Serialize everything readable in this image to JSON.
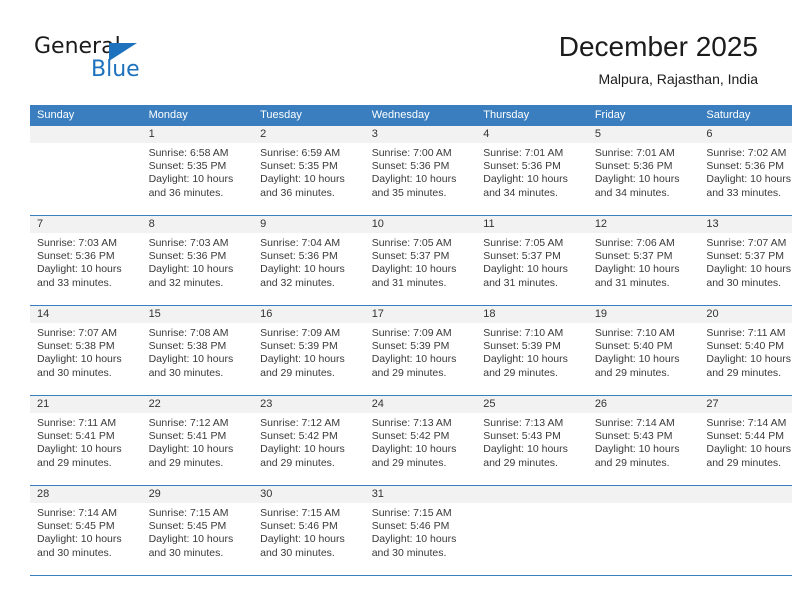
{
  "logo": {
    "word_top": "General",
    "word_bottom": "Blue",
    "triangle_icon": "blue-triangle-icon",
    "accent_color": "#1e72bd"
  },
  "header": {
    "title": "December 2025",
    "subtitle": "Malpura, Rajasthan, India"
  },
  "theme": {
    "header_blue": "#3a7ebf",
    "daynum_band": "#f2f2f2",
    "text": "#3a3a3a"
  },
  "calendar": {
    "weekday_headers": [
      "Sunday",
      "Monday",
      "Tuesday",
      "Wednesday",
      "Thursday",
      "Friday",
      "Saturday"
    ],
    "labels": {
      "sunrise": "Sunrise:",
      "sunset": "Sunset:",
      "daylight": "Daylight:"
    },
    "weeks": [
      [
        {
          "day": "",
          "sunrise": "",
          "sunset": "",
          "daylight": ""
        },
        {
          "day": "1",
          "sunrise": "Sunrise: 6:58 AM",
          "sunset": "Sunset: 5:35 PM",
          "daylight": "Daylight: 10 hours and 36 minutes."
        },
        {
          "day": "2",
          "sunrise": "Sunrise: 6:59 AM",
          "sunset": "Sunset: 5:35 PM",
          "daylight": "Daylight: 10 hours and 36 minutes."
        },
        {
          "day": "3",
          "sunrise": "Sunrise: 7:00 AM",
          "sunset": "Sunset: 5:36 PM",
          "daylight": "Daylight: 10 hours and 35 minutes."
        },
        {
          "day": "4",
          "sunrise": "Sunrise: 7:01 AM",
          "sunset": "Sunset: 5:36 PM",
          "daylight": "Daylight: 10 hours and 34 minutes."
        },
        {
          "day": "5",
          "sunrise": "Sunrise: 7:01 AM",
          "sunset": "Sunset: 5:36 PM",
          "daylight": "Daylight: 10 hours and 34 minutes."
        },
        {
          "day": "6",
          "sunrise": "Sunrise: 7:02 AM",
          "sunset": "Sunset: 5:36 PM",
          "daylight": "Daylight: 10 hours and 33 minutes."
        }
      ],
      [
        {
          "day": "7",
          "sunrise": "Sunrise: 7:03 AM",
          "sunset": "Sunset: 5:36 PM",
          "daylight": "Daylight: 10 hours and 33 minutes."
        },
        {
          "day": "8",
          "sunrise": "Sunrise: 7:03 AM",
          "sunset": "Sunset: 5:36 PM",
          "daylight": "Daylight: 10 hours and 32 minutes."
        },
        {
          "day": "9",
          "sunrise": "Sunrise: 7:04 AM",
          "sunset": "Sunset: 5:36 PM",
          "daylight": "Daylight: 10 hours and 32 minutes."
        },
        {
          "day": "10",
          "sunrise": "Sunrise: 7:05 AM",
          "sunset": "Sunset: 5:37 PM",
          "daylight": "Daylight: 10 hours and 31 minutes."
        },
        {
          "day": "11",
          "sunrise": "Sunrise: 7:05 AM",
          "sunset": "Sunset: 5:37 PM",
          "daylight": "Daylight: 10 hours and 31 minutes."
        },
        {
          "day": "12",
          "sunrise": "Sunrise: 7:06 AM",
          "sunset": "Sunset: 5:37 PM",
          "daylight": "Daylight: 10 hours and 31 minutes."
        },
        {
          "day": "13",
          "sunrise": "Sunrise: 7:07 AM",
          "sunset": "Sunset: 5:37 PM",
          "daylight": "Daylight: 10 hours and 30 minutes."
        }
      ],
      [
        {
          "day": "14",
          "sunrise": "Sunrise: 7:07 AM",
          "sunset": "Sunset: 5:38 PM",
          "daylight": "Daylight: 10 hours and 30 minutes."
        },
        {
          "day": "15",
          "sunrise": "Sunrise: 7:08 AM",
          "sunset": "Sunset: 5:38 PM",
          "daylight": "Daylight: 10 hours and 30 minutes."
        },
        {
          "day": "16",
          "sunrise": "Sunrise: 7:09 AM",
          "sunset": "Sunset: 5:39 PM",
          "daylight": "Daylight: 10 hours and 29 minutes."
        },
        {
          "day": "17",
          "sunrise": "Sunrise: 7:09 AM",
          "sunset": "Sunset: 5:39 PM",
          "daylight": "Daylight: 10 hours and 29 minutes."
        },
        {
          "day": "18",
          "sunrise": "Sunrise: 7:10 AM",
          "sunset": "Sunset: 5:39 PM",
          "daylight": "Daylight: 10 hours and 29 minutes."
        },
        {
          "day": "19",
          "sunrise": "Sunrise: 7:10 AM",
          "sunset": "Sunset: 5:40 PM",
          "daylight": "Daylight: 10 hours and 29 minutes."
        },
        {
          "day": "20",
          "sunrise": "Sunrise: 7:11 AM",
          "sunset": "Sunset: 5:40 PM",
          "daylight": "Daylight: 10 hours and 29 minutes."
        }
      ],
      [
        {
          "day": "21",
          "sunrise": "Sunrise: 7:11 AM",
          "sunset": "Sunset: 5:41 PM",
          "daylight": "Daylight: 10 hours and 29 minutes."
        },
        {
          "day": "22",
          "sunrise": "Sunrise: 7:12 AM",
          "sunset": "Sunset: 5:41 PM",
          "daylight": "Daylight: 10 hours and 29 minutes."
        },
        {
          "day": "23",
          "sunrise": "Sunrise: 7:12 AM",
          "sunset": "Sunset: 5:42 PM",
          "daylight": "Daylight: 10 hours and 29 minutes."
        },
        {
          "day": "24",
          "sunrise": "Sunrise: 7:13 AM",
          "sunset": "Sunset: 5:42 PM",
          "daylight": "Daylight: 10 hours and 29 minutes."
        },
        {
          "day": "25",
          "sunrise": "Sunrise: 7:13 AM",
          "sunset": "Sunset: 5:43 PM",
          "daylight": "Daylight: 10 hours and 29 minutes."
        },
        {
          "day": "26",
          "sunrise": "Sunrise: 7:14 AM",
          "sunset": "Sunset: 5:43 PM",
          "daylight": "Daylight: 10 hours and 29 minutes."
        },
        {
          "day": "27",
          "sunrise": "Sunrise: 7:14 AM",
          "sunset": "Sunset: 5:44 PM",
          "daylight": "Daylight: 10 hours and 29 minutes."
        }
      ],
      [
        {
          "day": "28",
          "sunrise": "Sunrise: 7:14 AM",
          "sunset": "Sunset: 5:45 PM",
          "daylight": "Daylight: 10 hours and 30 minutes."
        },
        {
          "day": "29",
          "sunrise": "Sunrise: 7:15 AM",
          "sunset": "Sunset: 5:45 PM",
          "daylight": "Daylight: 10 hours and 30 minutes."
        },
        {
          "day": "30",
          "sunrise": "Sunrise: 7:15 AM",
          "sunset": "Sunset: 5:46 PM",
          "daylight": "Daylight: 10 hours and 30 minutes."
        },
        {
          "day": "31",
          "sunrise": "Sunrise: 7:15 AM",
          "sunset": "Sunset: 5:46 PM",
          "daylight": "Daylight: 10 hours and 30 minutes."
        },
        {
          "day": "",
          "sunrise": "",
          "sunset": "",
          "daylight": ""
        },
        {
          "day": "",
          "sunrise": "",
          "sunset": "",
          "daylight": ""
        },
        {
          "day": "",
          "sunrise": "",
          "sunset": "",
          "daylight": ""
        }
      ]
    ]
  }
}
